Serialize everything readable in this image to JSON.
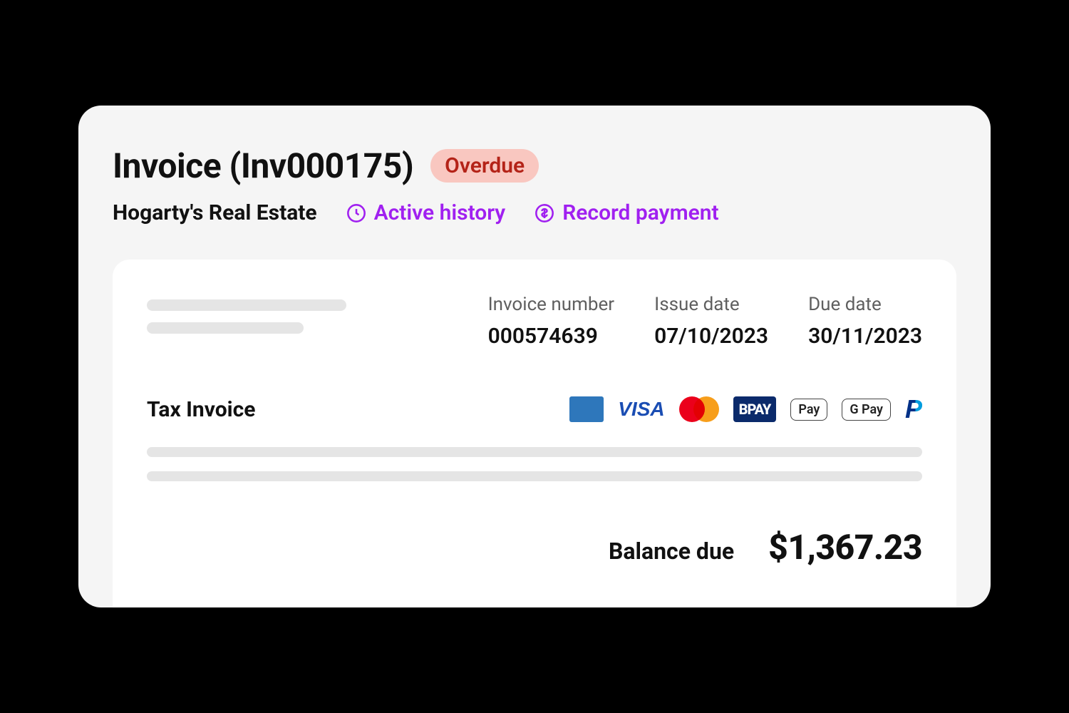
{
  "header": {
    "title": "Invoice (Inv000175)",
    "status": "Overdue"
  },
  "subheader": {
    "vendor": "Hogarty's Real Estate",
    "actions": {
      "history_label": "Active history",
      "record_payment_label": "Record payment"
    }
  },
  "invoice": {
    "meta": {
      "number_label": "Invoice number",
      "number_value": "000574639",
      "issue_label": "Issue date",
      "issue_value": "07/10/2023",
      "due_label": "Due date",
      "due_value": "30/11/2023"
    },
    "tax_title": "Tax Invoice",
    "payment_methods": {
      "visa": "VISA",
      "bpay": "BPAY",
      "apple_pay": "Pay",
      "google_pay": "G Pay",
      "paypal": "P"
    },
    "balance": {
      "label": "Balance due",
      "value": "$1,367.23"
    }
  }
}
